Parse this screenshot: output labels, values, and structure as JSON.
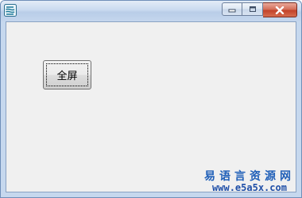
{
  "window": {
    "title": ""
  },
  "client": {
    "button_label": "全屏"
  },
  "watermark": {
    "title": "易语言资源网",
    "url": "www.e5a5x.com"
  },
  "colors": {
    "close_button": "#c2432a",
    "client_background": "#f0f0f0",
    "watermark_text": "#1f5fb8"
  },
  "icons": [
    "app-icon",
    "minimize-icon",
    "maximize-icon",
    "close-icon"
  ]
}
